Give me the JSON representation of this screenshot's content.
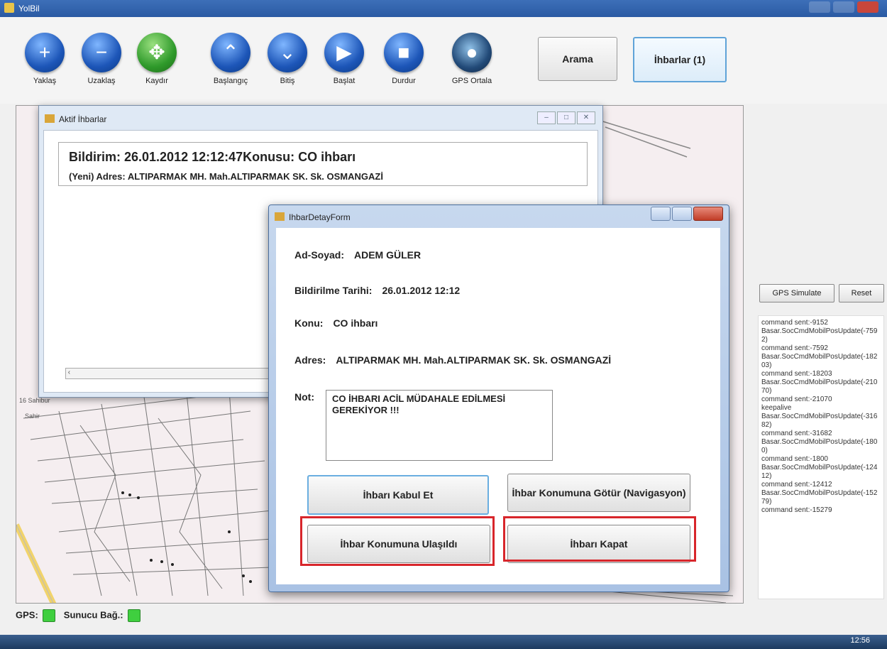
{
  "window": {
    "title": "YolBil"
  },
  "toolbar": {
    "buttons": [
      {
        "label": "Yaklaş",
        "icon": "plus-icon"
      },
      {
        "label": "Uzaklaş",
        "icon": "minus-icon"
      },
      {
        "label": "Kaydır",
        "icon": "move-icon"
      },
      {
        "label": "Başlangıç",
        "icon": "double-up-icon"
      },
      {
        "label": "Bitiş",
        "icon": "double-down-icon"
      },
      {
        "label": "Başlat",
        "icon": "play-icon"
      },
      {
        "label": "Durdur",
        "icon": "stop-icon"
      },
      {
        "label": "GPS Ortala",
        "icon": "globe-icon"
      }
    ],
    "search_label": "Arama",
    "reports_label": "İhbarlar (1)"
  },
  "aktif_window": {
    "title": "Aktif İhbarlar",
    "item_line1": "Bildirim: 26.01.2012 12:12:47Konusu: CO ihbarı",
    "item_line2": "(Yeni) Adres: ALTIPARMAK MH. Mah.ALTIPARMAK SK. Sk. OSMANGAZİ"
  },
  "detail_form": {
    "title": "IhbarDetayForm",
    "name_label": "Ad-Soyad:",
    "name_value": "ADEM GÜLER",
    "date_label": "Bildirilme Tarihi:",
    "date_value": "26.01.2012 12:12",
    "subject_label": "Konu:",
    "subject_value": "CO ihbarı",
    "address_label": "Adres:",
    "address_value": "ALTIPARMAK MH. Mah.ALTIPARMAK SK. Sk. OSMANGAZİ",
    "note_label": "Not:",
    "note_value": "CO İHBARI ACİL MÜDAHALE EDİLMESİ GEREKİYOR !!!",
    "accept_label": "İhbarı Kabul Et",
    "navigate_label": "İhbar Konumuna Götür (Navigasyon)",
    "arrived_label": "İhbar Konumuna Ulaşıldı",
    "close_label": "İhbarı Kapat"
  },
  "side_panel": {
    "gps_simulate_label": "GPS Simulate",
    "reset_label": "Reset",
    "log": [
      "command sent:-9152",
      "Basar.SocCmdMobilPosUpdate(-7592)",
      "command sent:-7592",
      "Basar.SocCmdMobilPosUpdate(-18203)",
      "command sent:-18203",
      "Basar.SocCmdMobilPosUpdate(-21070)",
      "command sent:-21070",
      "keepalive",
      "Basar.SocCmdMobilPosUpdate(-31682)",
      "command sent:-31682",
      "Basar.SocCmdMobilPosUpdate(-1800)",
      "command sent:-1800",
      "Basar.SocCmdMobilPosUpdate(-12412)",
      "command sent:-12412",
      "Basar.SocCmdMobilPosUpdate(-15279)",
      "command sent:-15279"
    ]
  },
  "status": {
    "gps_label": "GPS:",
    "server_label": "Sunucu Bağ.:"
  },
  "map_labels": {
    "sahir": "Sahir",
    "street_16": "16 Sahibur"
  },
  "taskbar": {
    "clock": "12:56"
  },
  "colors": {
    "highlight": "#d8262b",
    "led": "#3fcf3f",
    "accent": "#1d56b8"
  }
}
